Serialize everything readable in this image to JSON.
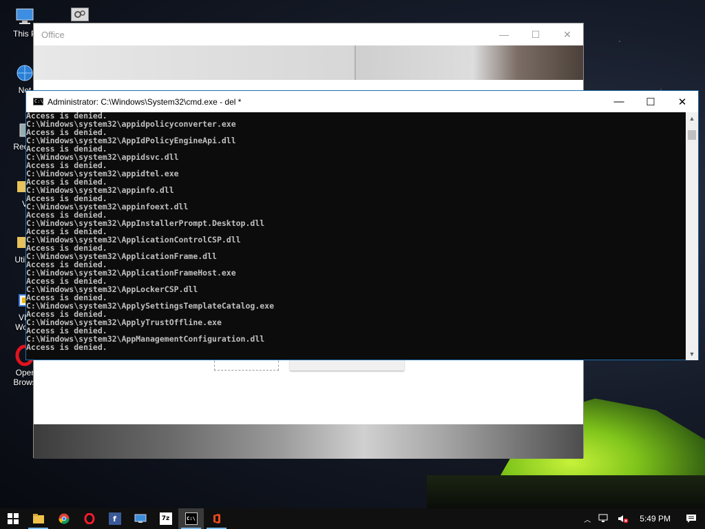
{
  "desktop": {
    "icons": [
      {
        "label": "This P"
      },
      {
        "label": "Net"
      },
      {
        "label": "Recyc"
      },
      {
        "label": "V"
      },
      {
        "label": "Utility"
      },
      {
        "label": "VM"
      },
      {
        "label": "Work"
      },
      {
        "label": "Oper"
      },
      {
        "label": "Brows"
      }
    ]
  },
  "office_window": {
    "title": "Office",
    "controls": {
      "minimize": "—",
      "maximize": "☐",
      "close": "✕"
    }
  },
  "cmd_window": {
    "title": "Administrator: C:\\Windows\\System32\\cmd.exe - del  *",
    "icon_text": "C:\\",
    "controls": {
      "minimize": "—",
      "maximize": "☐",
      "close": "✕"
    },
    "lines": [
      "Access is denied.",
      "C:\\Windows\\system32\\appidpolicyconverter.exe",
      "Access is denied.",
      "C:\\Windows\\system32\\AppIdPolicyEngineApi.dll",
      "Access is denied.",
      "C:\\Windows\\system32\\appidsvc.dll",
      "Access is denied.",
      "C:\\Windows\\system32\\appidtel.exe",
      "Access is denied.",
      "C:\\Windows\\system32\\appinfo.dll",
      "Access is denied.",
      "C:\\Windows\\system32\\appinfoext.dll",
      "Access is denied.",
      "C:\\Windows\\system32\\AppInstallerPrompt.Desktop.dll",
      "Access is denied.",
      "C:\\Windows\\system32\\ApplicationControlCSP.dll",
      "Access is denied.",
      "C:\\Windows\\system32\\ApplicationFrame.dll",
      "Access is denied.",
      "C:\\Windows\\system32\\ApplicationFrameHost.exe",
      "Access is denied.",
      "C:\\Windows\\system32\\AppLockerCSP.dll",
      "Access is denied.",
      "C:\\Windows\\system32\\ApplySettingsTemplateCatalog.exe",
      "Access is denied.",
      "C:\\Windows\\system32\\ApplyTrustOffline.exe",
      "Access is denied.",
      "C:\\Windows\\system32\\AppManagementConfiguration.dll",
      "Access is denied."
    ]
  },
  "taskbar": {
    "apps": [
      {
        "icon": "windows-start-icon"
      },
      {
        "icon": "file-explorer-icon"
      },
      {
        "icon": "chrome-icon"
      },
      {
        "icon": "opera-icon"
      },
      {
        "icon": "facebook-icon",
        "glyph": "f"
      },
      {
        "icon": "remote-desktop-icon"
      },
      {
        "icon": "7zip-icon",
        "glyph": "7z"
      },
      {
        "icon": "cmd-icon",
        "glyph": "C:\\"
      },
      {
        "icon": "office-icon"
      }
    ],
    "tray": {
      "chevron": "^",
      "clock": "5:49 PM"
    }
  },
  "colors": {
    "console_bg": "#0c0c0c",
    "console_fg": "#c0c0c0",
    "taskbar_bg": "#101010",
    "accent": "#76b9ed"
  }
}
